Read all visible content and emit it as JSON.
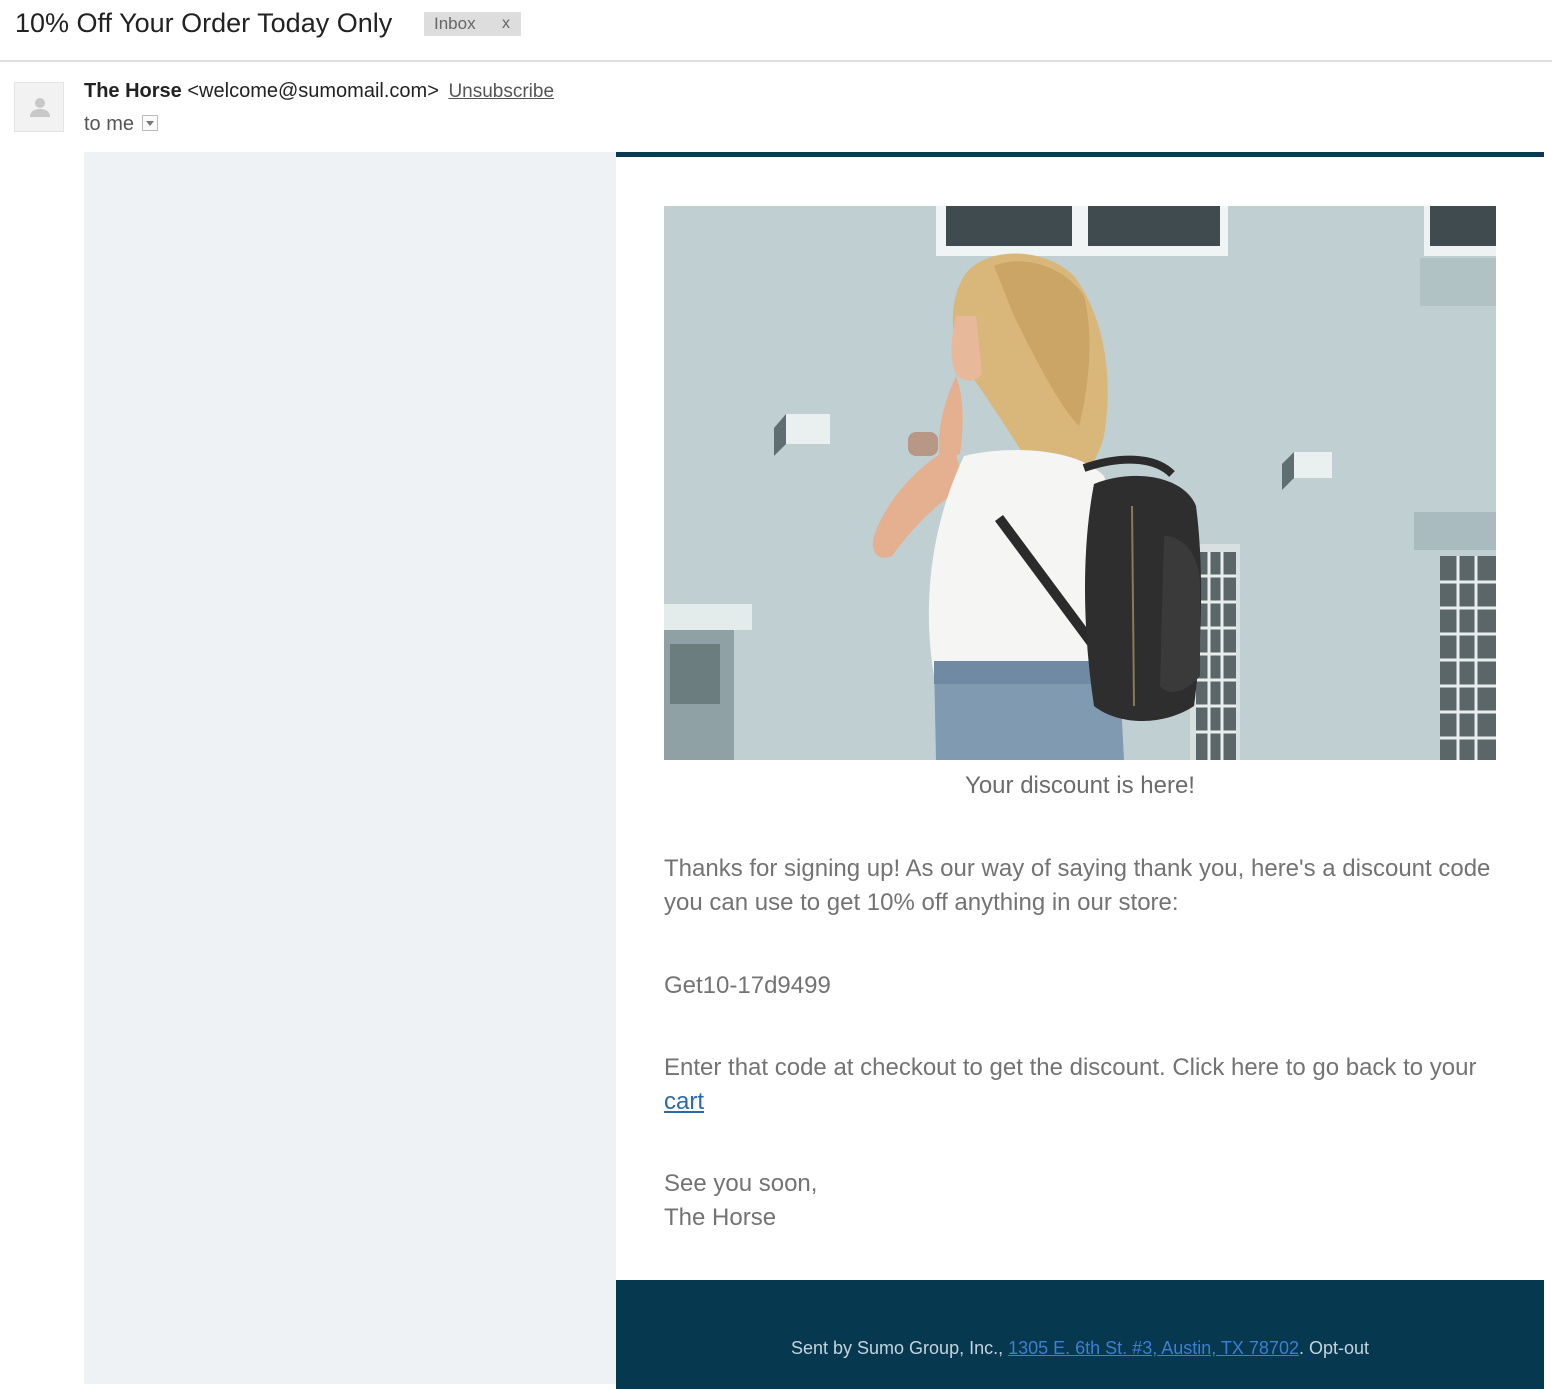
{
  "email": {
    "subject": "10% Off Your Order Today Only",
    "label_chip": "Inbox",
    "label_remove": "x",
    "sender_name": "The Horse",
    "sender_email": "<welcome@sumomail.com>",
    "unsubscribe": "Unsubscribe",
    "to_line": "to me"
  },
  "body": {
    "caption": "Your discount is here!",
    "intro": "Thanks for signing up! As our way of saying thank you, here's a discount code you can use to get 10% off anything in our store:",
    "code": "Get10-17d9499",
    "instructions_prefix": "Enter that code at checkout to get the discount. Click here to go back to your ",
    "cart_link": "cart",
    "signoff_line1": "See you soon,",
    "signoff_line2": "The Horse"
  },
  "footer": {
    "prefix": "Sent by Sumo Group, Inc., ",
    "address": "1305 E. 6th St. #3, Austin, TX 78702",
    "separator": ". ",
    "optout": "Opt-out"
  },
  "colors": {
    "brand_navy": "#06384f",
    "link_blue": "#2b6aa6",
    "panel_gray": "#eff2f5"
  },
  "icons": {
    "avatar": "person-silhouette-icon",
    "recipient_dropdown": "chevron-down-icon"
  }
}
